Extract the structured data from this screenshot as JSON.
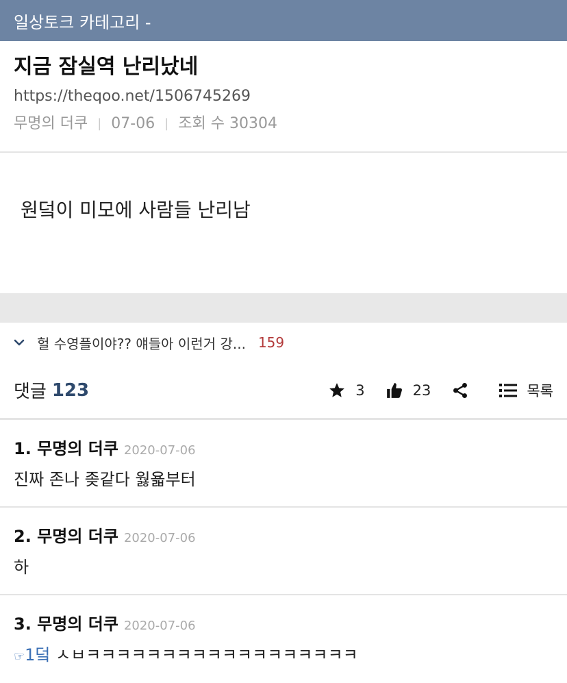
{
  "topbar": {
    "category": "일상토크 카테고리 -"
  },
  "post": {
    "title": "지금 잠실역 난리났네",
    "url": "https://theqoo.net/1506745269",
    "author": "무명의 더쿠",
    "date": "07-06",
    "views": "조회 수 30304",
    "body": "원덬이 미모에 사람들 난리남"
  },
  "related": {
    "title": "헐 수영플이야?? 얘들아 이런거 강...",
    "count": "159"
  },
  "actions": {
    "comments_label": "댓글",
    "comments_count": "123",
    "star_count": "3",
    "like_count": "23",
    "list_label": "목록"
  },
  "comments": [
    {
      "author": "1. 무명의 더쿠",
      "date": "2020-07-06",
      "text": "진짜 존나 좆같다 웛욟부터"
    },
    {
      "author": "2. 무명의 더쿠",
      "date": "2020-07-06",
      "text": "하"
    },
    {
      "author": "3. 무명의 더쿠",
      "date": "2020-07-06",
      "reply_icon": "☞",
      "reply": "1덬",
      "text": " ㅅㅂㅋㅋㅋㅋㅋㅋㅋㅋㅋㅋㅋㅋㅋㅋㅋㅋㅋㅋ"
    }
  ]
}
